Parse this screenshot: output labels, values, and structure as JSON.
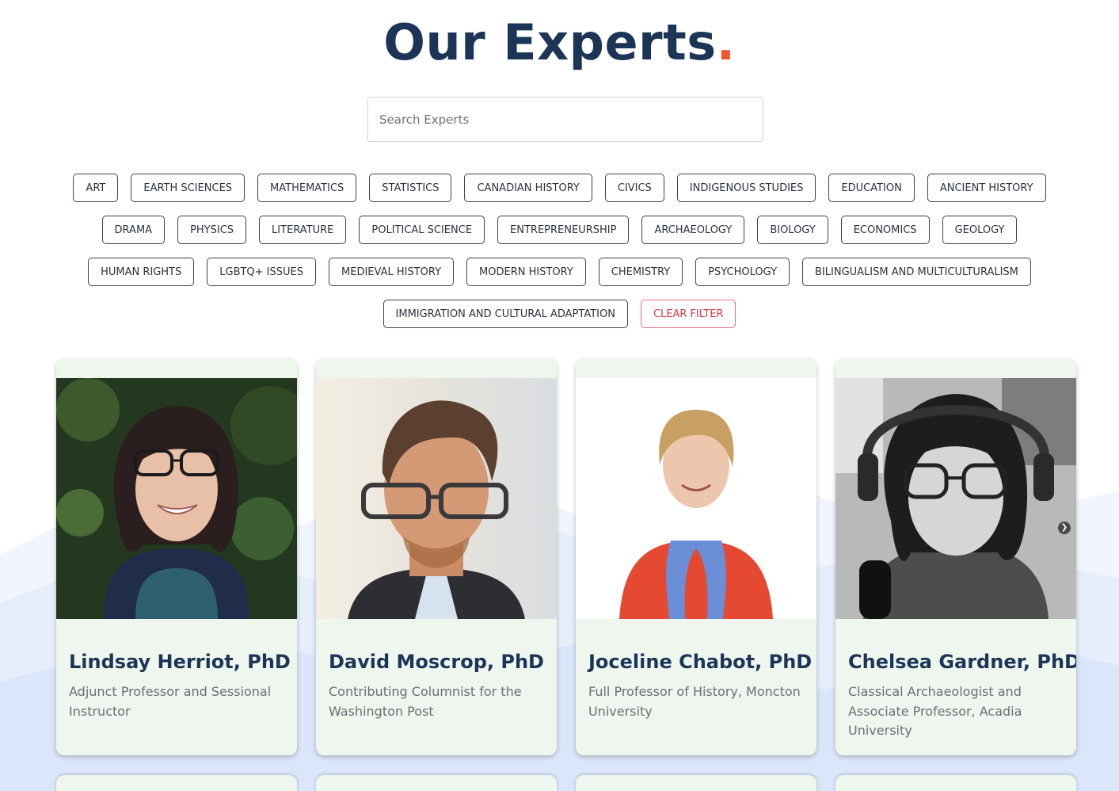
{
  "header": {
    "title": "Our Experts",
    "title_dot": "."
  },
  "search": {
    "placeholder": "Search Experts"
  },
  "filters": {
    "rows": [
      [
        "ART",
        "EARTH SCIENCES",
        "MATHEMATICS",
        "STATISTICS",
        "CANADIAN HISTORY",
        "CIVICS",
        "INDIGENOUS STUDIES",
        "EDUCATION",
        "ANCIENT HISTORY"
      ],
      [
        "DRAMA",
        "PHYSICS",
        "LITERATURE",
        "POLITICAL SCIENCE",
        "ENTREPRENEURSHIP",
        "ARCHAEOLOGY",
        "BIOLOGY",
        "ECONOMICS",
        "GEOLOGY"
      ],
      [
        "HUMAN RIGHTS",
        "LGBTQ+ ISSUES",
        "MEDIEVAL HISTORY",
        "MODERN HISTORY",
        "CHEMISTRY",
        "PSYCHOLOGY",
        "BILINGUALISM AND MULTICULTURALISM"
      ],
      [
        "IMMIGRATION AND CULTURAL ADAPTATION"
      ]
    ],
    "clear_label": "CLEAR FILTER"
  },
  "experts": [
    {
      "name": "Lindsay Herriot, PhD",
      "role": "Adjunct Professor and Sessional Instructor"
    },
    {
      "name": "David Moscrop, PhD",
      "role": "Contributing Columnist for the Washington Post"
    },
    {
      "name": "Joceline Chabot, PhD",
      "role": "Full Professor of History, Moncton University"
    },
    {
      "name": "Chelsea Gardner, PhD",
      "role": "Classical Archaeologist and Associate Professor, Acadia University"
    }
  ],
  "colors": {
    "title": "#1c3557",
    "accent": "#f0552b",
    "card_bg": "#eef6ee",
    "clear_filter": "#d6394a"
  },
  "icons": {
    "carousel_next": "chevron-right-icon"
  }
}
